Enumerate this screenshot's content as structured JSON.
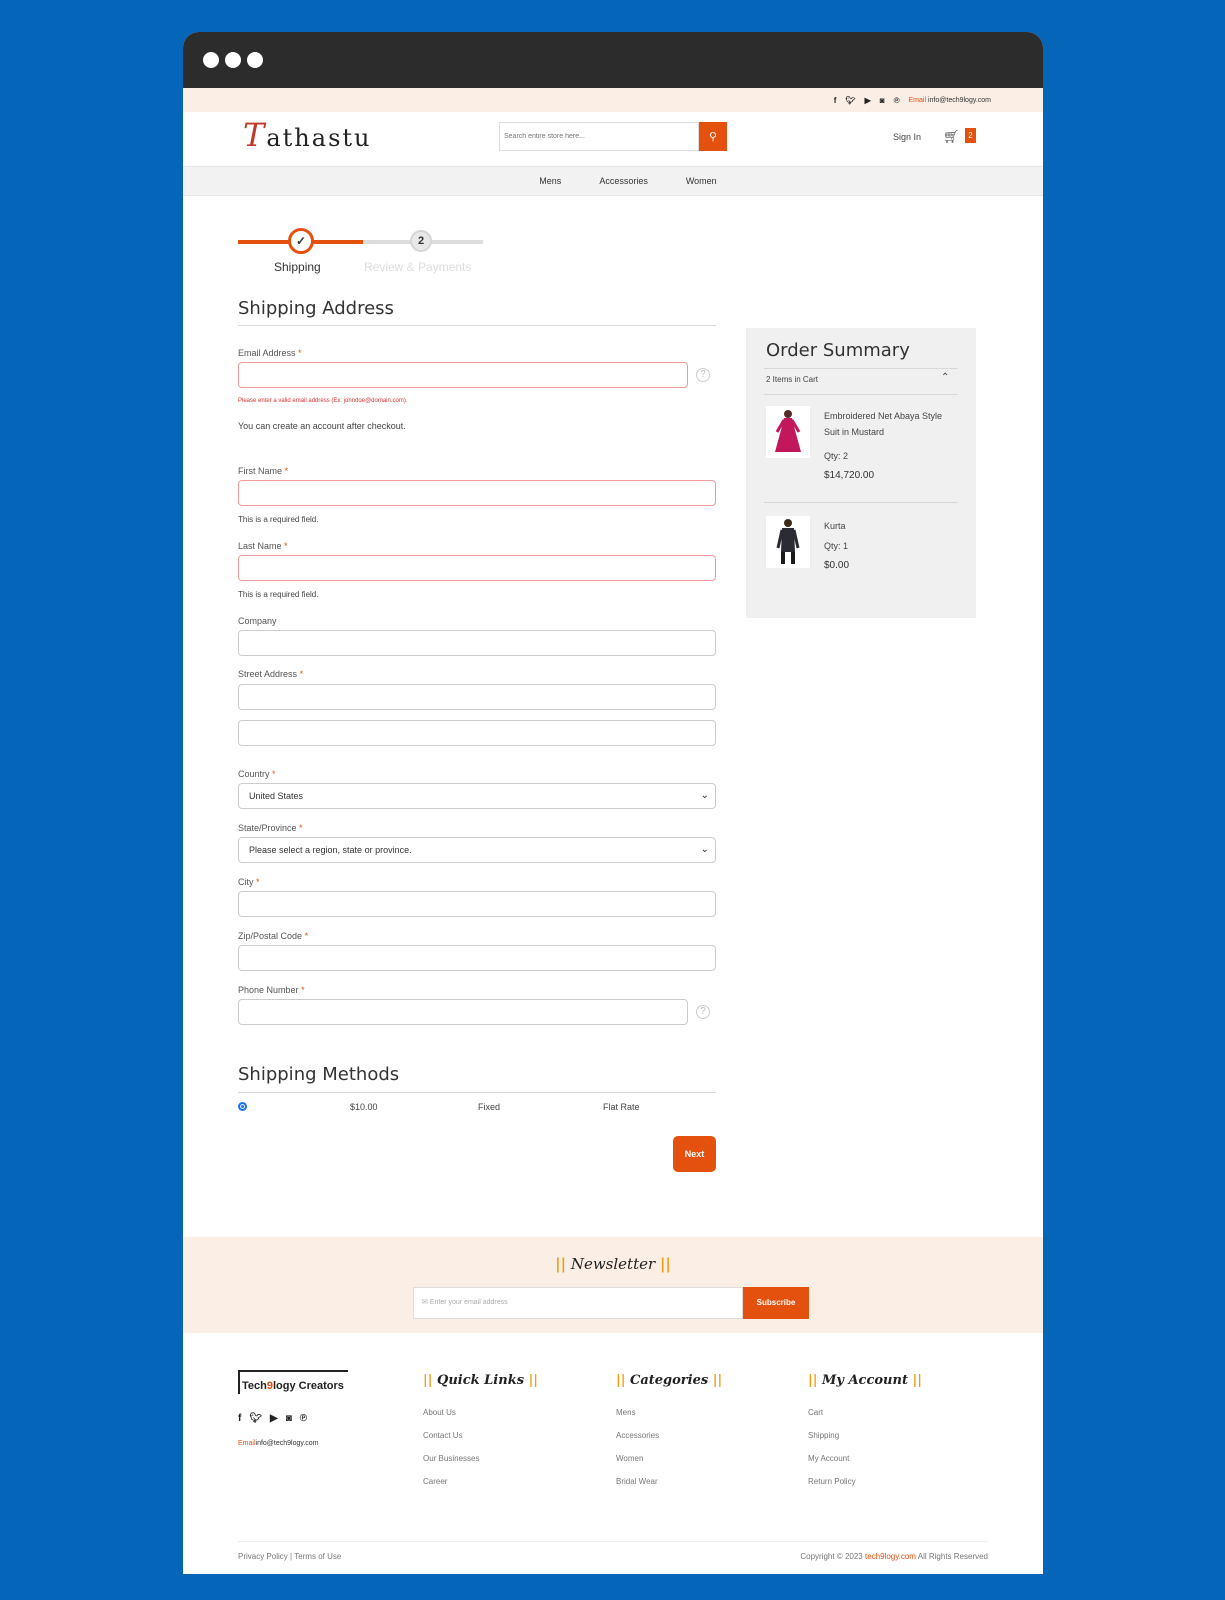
{
  "topbar": {
    "social_icons": [
      "facebook-icon",
      "twitter-icon",
      "youtube-icon",
      "instagram-icon",
      "pinterest-icon"
    ],
    "email_label": "Email",
    "email": "info@tech9logy.com"
  },
  "header": {
    "logo_first": "T",
    "logo_rest": "athastu",
    "search_placeholder": "Search entire store here...",
    "sign_in": "Sign In",
    "cart_count": "2"
  },
  "nav": {
    "items": [
      "Mens",
      "Accessories",
      "Women"
    ]
  },
  "steps": {
    "step1": "Shipping",
    "step2_num": "2",
    "step2": "Review & Payments"
  },
  "shipping": {
    "title": "Shipping Address",
    "email_label": "Email Address",
    "email_error": "Please enter a valid email address (Ex: johndoe@domain.com).",
    "account_note": "You can create an account after checkout.",
    "first_name_label": "First Name",
    "required_error": "This is a required field.",
    "last_name_label": "Last Name",
    "company_label": "Company",
    "street_label": "Street Address",
    "country_label": "Country",
    "country_value": "United States",
    "state_label": "State/Province",
    "state_value": "Please select a region, state or province.",
    "city_label": "City",
    "zip_label": "Zip/Postal Code",
    "phone_label": "Phone Number",
    "required_mark": "*"
  },
  "methods": {
    "title": "Shipping Methods",
    "price": "$10.00",
    "type": "Fixed",
    "carrier": "Flat Rate",
    "next": "Next"
  },
  "summary": {
    "title": "Order Summary",
    "items_count": "2 Items in Cart",
    "items": [
      {
        "name": "Embroidered Net Abaya Style Suit in Mustard",
        "qty": "Qty: 2",
        "price": "$14,720.00"
      },
      {
        "name": "Kurta",
        "qty": "Qty: 1",
        "price": "$0.00"
      }
    ]
  },
  "newsletter": {
    "bars": "||",
    "title": "Newsletter",
    "placeholder": "Enter your email address",
    "button": "Subscribe"
  },
  "footer": {
    "brand_a": "Tech",
    "brand_b": "9",
    "brand_c": "logy Creators",
    "email_label": "Email",
    "email": "info@tech9logy.com",
    "quick_links": {
      "title": "Quick Links",
      "items": [
        "About Us",
        "Contact Us",
        "Our Businesses",
        "Career"
      ]
    },
    "categories": {
      "title": "Categories",
      "items": [
        "Mens",
        "Accessories",
        "Women",
        "Bridal Wear"
      ]
    },
    "account": {
      "title": "My Account",
      "items": [
        "Cart",
        "Shipping",
        "My Account",
        "Return Policy"
      ]
    },
    "privacy": "Privacy Policy",
    "separator": "|",
    "terms": "Terms of Use",
    "copyright_pre": "Copyright © 2023",
    "copyright_brand": "tech9logy.com",
    "copyright_post": "All Rights Reserved"
  },
  "colors": {
    "accent": "#e4500e",
    "background": "#0565b9",
    "cream": "#fbeee4"
  }
}
